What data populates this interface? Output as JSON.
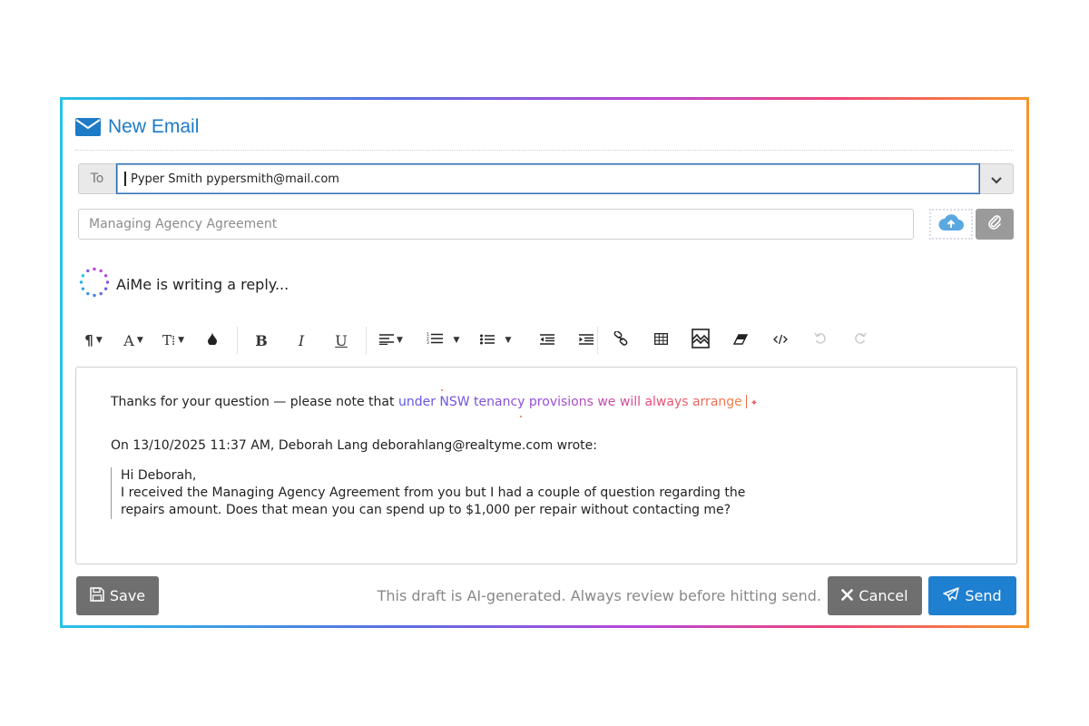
{
  "window": {
    "title": "New Email"
  },
  "compose": {
    "to_label": "To",
    "to_value": "Pyper Smith pypersmith@mail.com",
    "subject_placeholder": "Managing Agency Agreement"
  },
  "ai_status": "AiMe is writing a reply...",
  "toolbar": {
    "icons": [
      "paragraph-icon",
      "font-color-icon",
      "font-size-icon",
      "highlight-icon",
      "bold-icon",
      "italic-icon",
      "underline-icon",
      "align-icon",
      "ordered-list-icon",
      "unordered-list-icon",
      "outdent-icon",
      "indent-icon",
      "link-icon",
      "table-icon",
      "image-icon",
      "eraser-icon",
      "code-view-icon",
      "undo-icon",
      "redo-icon"
    ],
    "paragraph_glyph": "¶",
    "font_glyph": "A",
    "fontsize_glyph": "T⁞",
    "bold_glyph": "B",
    "italic_glyph": "I",
    "underline_glyph": "U"
  },
  "body": {
    "line1_prefix": "Thanks for your question — please note that ",
    "line1_ai": "under NSW tenancy provisions we will always arrange",
    "quote_header": "On 13/10/2025 11:37 AM, Deborah Lang deborahlang@realtyme.com wrote:",
    "quote_lines": [
      "Hi Deborah,",
      "I received the Managing Agency Agreement from you but I had a couple of question regarding the",
      "repairs amount. Does that mean you can spend up to $1,000 per repair without contacting me?"
    ]
  },
  "footer": {
    "save_label": "Save",
    "disclaimer": "This draft is AI-generated. Always review before hitting send.",
    "cancel_label": "Cancel",
    "send_label": "Send"
  },
  "colors": {
    "brand_blue": "#1e7bc7",
    "send_blue": "#1f7fd1",
    "gray_button": "#6f6f6f",
    "gradient": [
      "#27c2e6",
      "#5a6fe0",
      "#b845d8",
      "#f0457a",
      "#f5962a"
    ]
  }
}
